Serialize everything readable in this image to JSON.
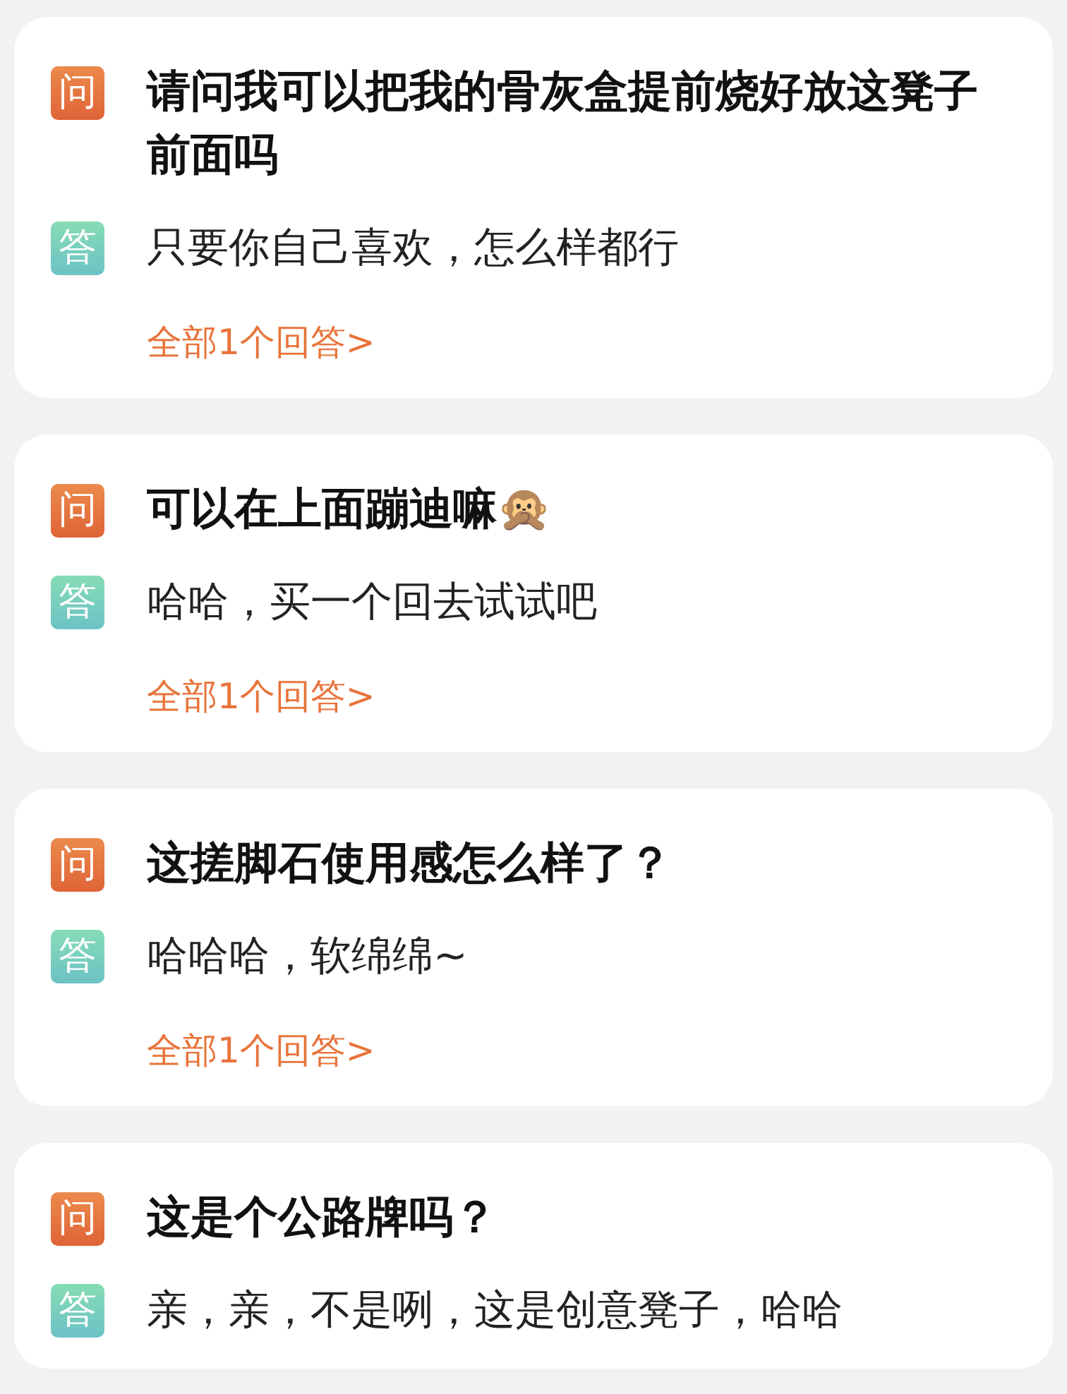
{
  "qa_cards": [
    {
      "question_badge": "问",
      "question": "请问我可以把我的骨灰盒提前烧好放这凳子前面吗",
      "answer_badge": "答",
      "answer": "只要你自己喜欢，怎么样都行",
      "more_link": "全部1个回答>"
    },
    {
      "question_badge": "问",
      "question": "可以在上面蹦迪嘛🙊",
      "answer_badge": "答",
      "answer": "哈哈，买一个回去试试吧",
      "more_link": "全部1个回答>"
    },
    {
      "question_badge": "问",
      "question": "这搓脚石使用感怎么样了？",
      "answer_badge": "答",
      "answer": "哈哈哈，软绵绵~",
      "more_link": "全部1个回答>"
    },
    {
      "question_badge": "问",
      "question": "这是个公路牌吗？",
      "answer_badge": "答",
      "answer": "亲，亲，不是咧，这是创意凳子，哈哈"
    }
  ]
}
